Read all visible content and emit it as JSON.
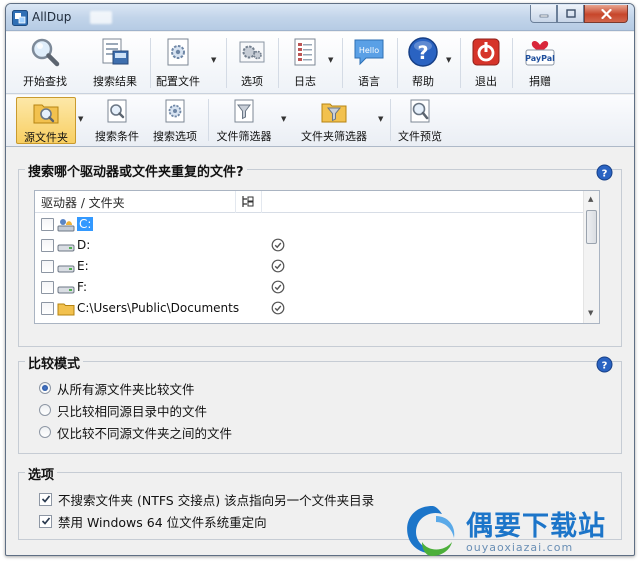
{
  "window": {
    "title": "AllDup"
  },
  "toolbar_main": {
    "items": [
      {
        "label": "开始查找",
        "icon": "magnifier-icon"
      },
      {
        "label": "搜索结果",
        "icon": "search-results-icon"
      },
      {
        "label": "配置文件",
        "icon": "profile-gear-icon"
      },
      {
        "label": "选项",
        "icon": "options-gear-icon"
      },
      {
        "label": "日志",
        "icon": "log-icon"
      },
      {
        "label": "语言",
        "icon": "language-icon",
        "badge": "Hello"
      },
      {
        "label": "帮助",
        "icon": "help-icon"
      },
      {
        "label": "退出",
        "icon": "exit-icon"
      },
      {
        "label": "捐赠",
        "icon": "paypal-icon",
        "badge": "PayPal"
      }
    ]
  },
  "toolbar_sub": {
    "items": [
      {
        "label": "源文件夹",
        "icon": "source-folder-icon",
        "active": true
      },
      {
        "label": "搜索条件",
        "icon": "search-criteria-icon"
      },
      {
        "label": "搜索选项",
        "icon": "search-options-icon"
      },
      {
        "label": "文件筛选器",
        "icon": "file-filter-icon"
      },
      {
        "label": "文件夹筛选器",
        "icon": "folder-filter-icon"
      },
      {
        "label": "文件预览",
        "icon": "file-preview-icon"
      }
    ]
  },
  "source_panel": {
    "title": "搜索哪个驱动器或文件夹重复的文件?",
    "column_name": "驱动器 / 文件夹",
    "rows": [
      {
        "label": "C:",
        "icon": "system-drive-icon",
        "selected": true
      },
      {
        "label": "D:",
        "icon": "drive-icon"
      },
      {
        "label": "E:",
        "icon": "drive-icon"
      },
      {
        "label": "F:",
        "icon": "drive-icon"
      },
      {
        "label": "C:\\Users\\Public\\Documents",
        "icon": "folder-icon"
      }
    ]
  },
  "compare_panel": {
    "title": "比较模式",
    "options": [
      {
        "label": "从所有源文件夹比较文件",
        "selected": true
      },
      {
        "label": "只比较相同源目录中的文件",
        "selected": false
      },
      {
        "label": "仅比较不同源文件夹之间的文件",
        "selected": false
      }
    ]
  },
  "options_panel": {
    "title": "选项",
    "items": [
      {
        "label": "不搜索文件夹 (NTFS 交接点) 该点指向另一个文件夹目录",
        "checked": true
      },
      {
        "label": "禁用 Windows 64 位文件系统重定向",
        "checked": true
      }
    ]
  },
  "watermark": {
    "title": "偶要下载站",
    "subtitle": "ouyaoxiazai.com"
  },
  "colors": {
    "accent": "#1c75c9",
    "selection": "#3399ff",
    "active_tab": "#f8cf63",
    "close_button": "#c7462b"
  }
}
